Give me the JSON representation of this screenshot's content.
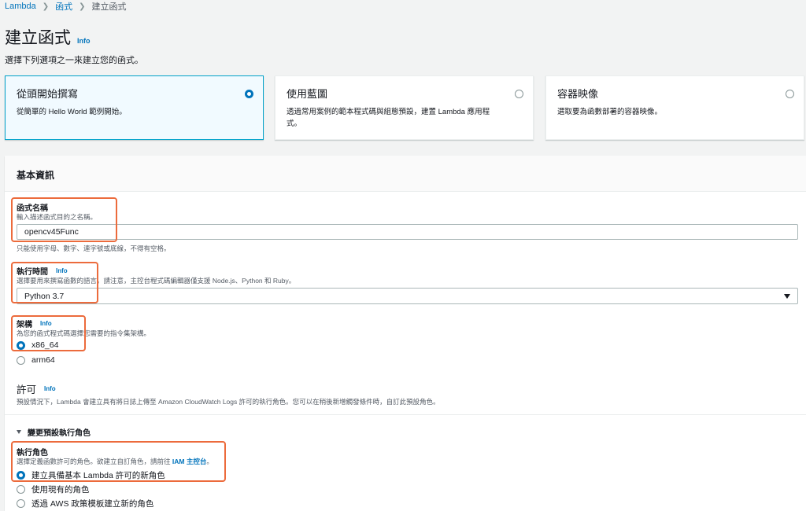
{
  "breadcrumb": {
    "items": [
      "Lambda",
      "函式",
      "建立函式"
    ]
  },
  "header": {
    "title": "建立函式",
    "info": "Info",
    "description": "選擇下列選項之一來建立您的函式。"
  },
  "options": [
    {
      "title": "從頭開始撰寫",
      "desc": "從簡單的 Hello World 範例開始。",
      "selected": true
    },
    {
      "title": "使用藍圖",
      "desc": "透過常用案例的範本程式碼與組態預設，建置 Lambda 應用程式。",
      "selected": false
    },
    {
      "title": "容器映像",
      "desc": "選取要為函數部署的容器映像。",
      "selected": false
    }
  ],
  "basic": {
    "title": "基本資訊",
    "function_name": {
      "label": "函式名稱",
      "desc": "輸入描述函式目的之名稱。",
      "value": "opencv45Func",
      "hint": "只能使用字母、數字、連字號或底線，不得有空格。"
    },
    "runtime": {
      "label": "執行時間",
      "info": "Info",
      "desc": "選擇要用來撰寫函數的語言。請注意，主控台程式碼編輯器僅支援 Node.js、Python 和 Ruby。",
      "value": "Python 3.7"
    },
    "architecture": {
      "label": "架構",
      "info": "Info",
      "desc": "為您的函式程式碼選擇您需要的指令集架構。",
      "options": [
        "x86_64",
        "arm64"
      ],
      "selected": "x86_64"
    },
    "permissions": {
      "title": "許可",
      "info": "Info",
      "desc": "預設情況下，Lambda 會建立具有將日誌上傳至 Amazon CloudWatch Logs 許可的執行角色。您可以在稍後新增觸發條件時，自訂此預設角色。"
    },
    "expander": "變更預設執行角色",
    "role": {
      "label": "執行角色",
      "desc": "選擇定義函數許可的角色。欲建立自訂角色，請前往",
      "link": "IAM 主控台",
      "desc_end": "。",
      "options": [
        "建立具備基本 Lambda 許可的新角色",
        "使用現有的角色",
        "透過 AWS 政策模板建立新的角色"
      ],
      "selected": "建立具備基本 Lambda 許可的新角色"
    }
  },
  "colors": {
    "link": "#0073bb",
    "highlight": "#ec6b3c",
    "selected_border": "#00a1c9"
  }
}
